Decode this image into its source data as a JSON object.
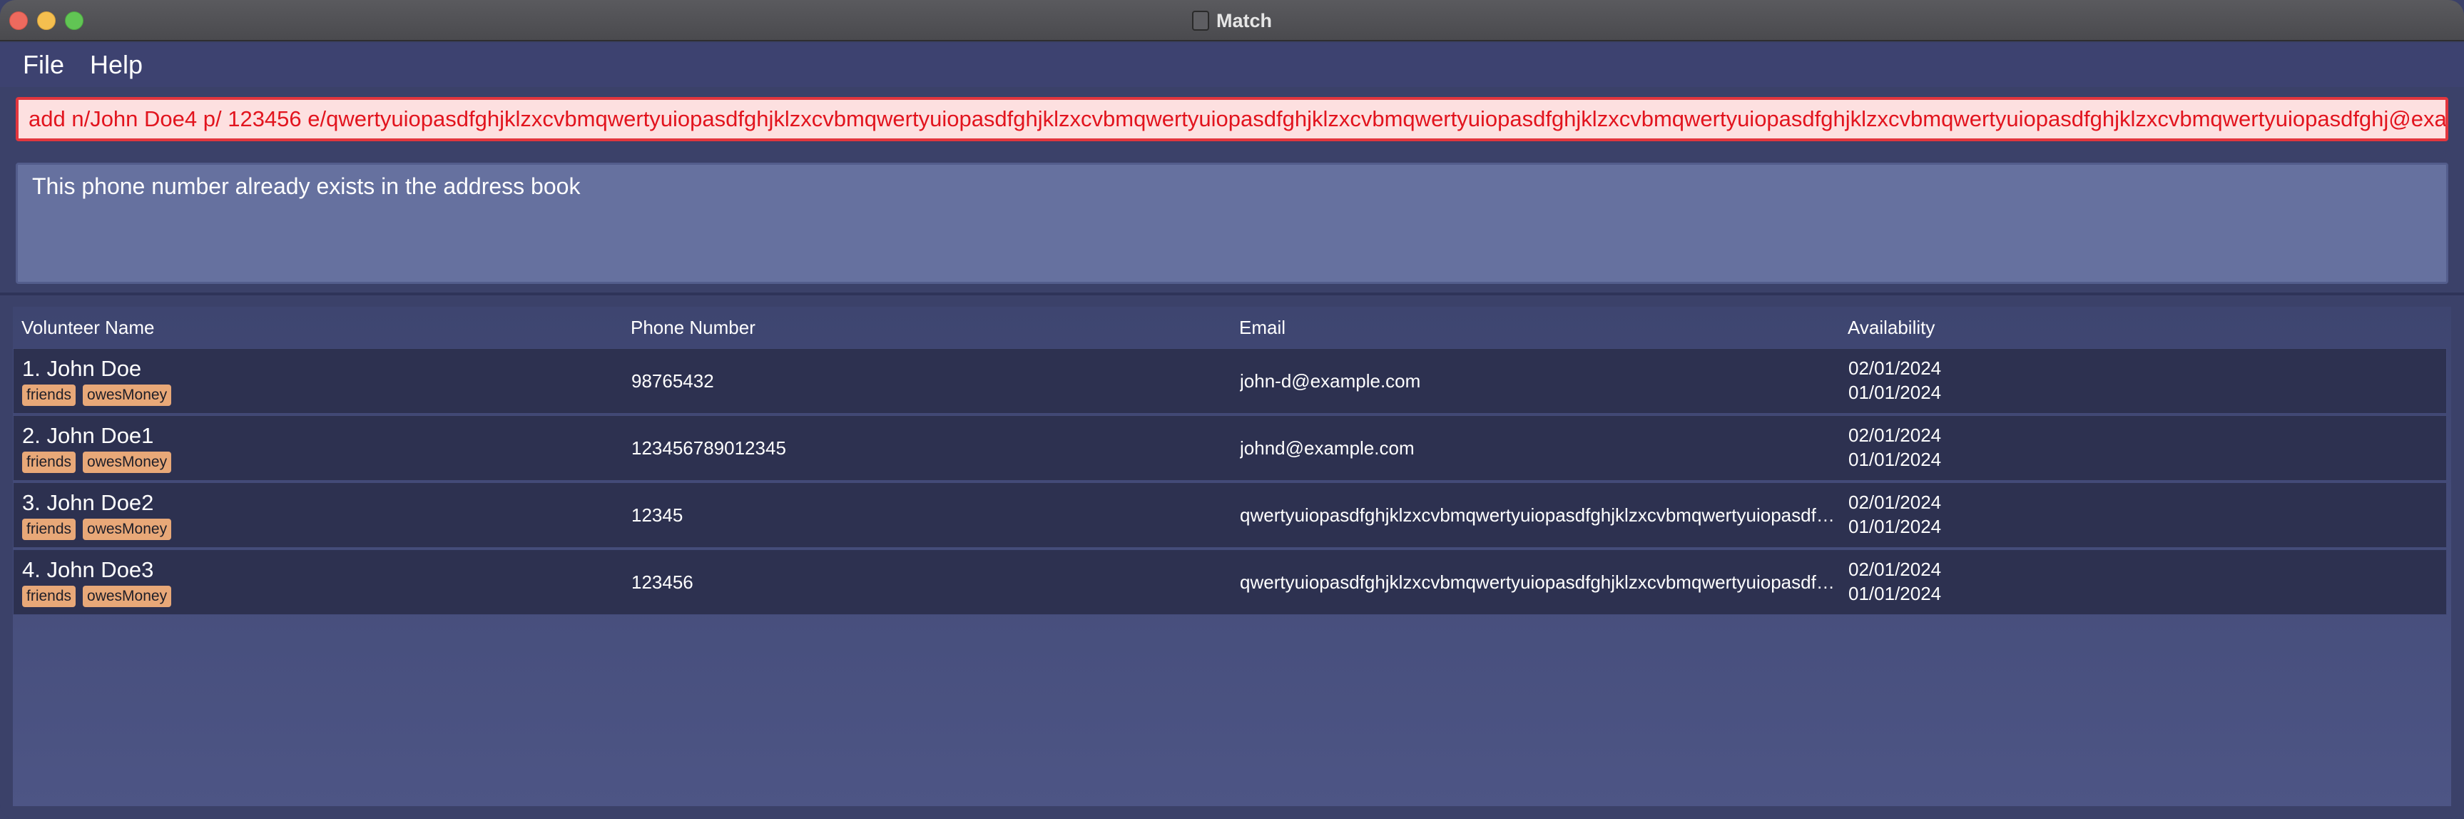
{
  "window": {
    "title": "Match"
  },
  "menu": {
    "items": [
      "File",
      "Help"
    ]
  },
  "command": {
    "value": "add n/John Doe4 p/ 123456 e/qwertyuiopasdfghjklzxcvbmqwertyuiopasdfghjklzxcvbmqwertyuiopasdfghjklzxcvbmqwertyuiopasdfghjklzxcvbmqwertyuiopasdfghjklzxcvbmqwertyuiopasdfghjklzxcvbmqwertyuiopasdfghjklzxcvbmqwertyuiopasdfghj@exa"
  },
  "result": {
    "message": "This phone number already exists in the address book"
  },
  "table": {
    "headers": [
      "Volunteer Name",
      "Phone Number",
      "Email",
      "Availability"
    ],
    "rows": [
      {
        "name": "1. John Doe",
        "tags": [
          "friends",
          "owesMoney"
        ],
        "phone": "98765432",
        "email": "john-d@example.com",
        "availability": [
          "02/01/2024",
          "01/01/2024"
        ]
      },
      {
        "name": "2. John Doe1",
        "tags": [
          "friends",
          "owesMoney"
        ],
        "phone": "123456789012345",
        "email": "johnd@example.com",
        "availability": [
          "02/01/2024",
          "01/01/2024"
        ]
      },
      {
        "name": "3. John Doe2",
        "tags": [
          "friends",
          "owesMoney"
        ],
        "phone": "12345",
        "email": "qwertyuiopasdfghjklzxcvbmqwertyuiopasdfghjklzxcvbmqwertyuiopasdfgh...",
        "availability": [
          "02/01/2024",
          "01/01/2024"
        ]
      },
      {
        "name": "4. John Doe3",
        "tags": [
          "friends",
          "owesMoney"
        ],
        "phone": "123456",
        "email": "qwertyuiopasdfghjklzxcvbmqwertyuiopasdfghjklzxcvbmqwertyuiopasdfgh...",
        "availability": [
          "02/01/2024",
          "01/01/2024"
        ]
      }
    ]
  },
  "colors": {
    "background": "#3b4169",
    "command_error_border": "#e2363e",
    "command_error_text": "#e2141e",
    "tag": "#e8a878",
    "row": "#2d3150"
  }
}
